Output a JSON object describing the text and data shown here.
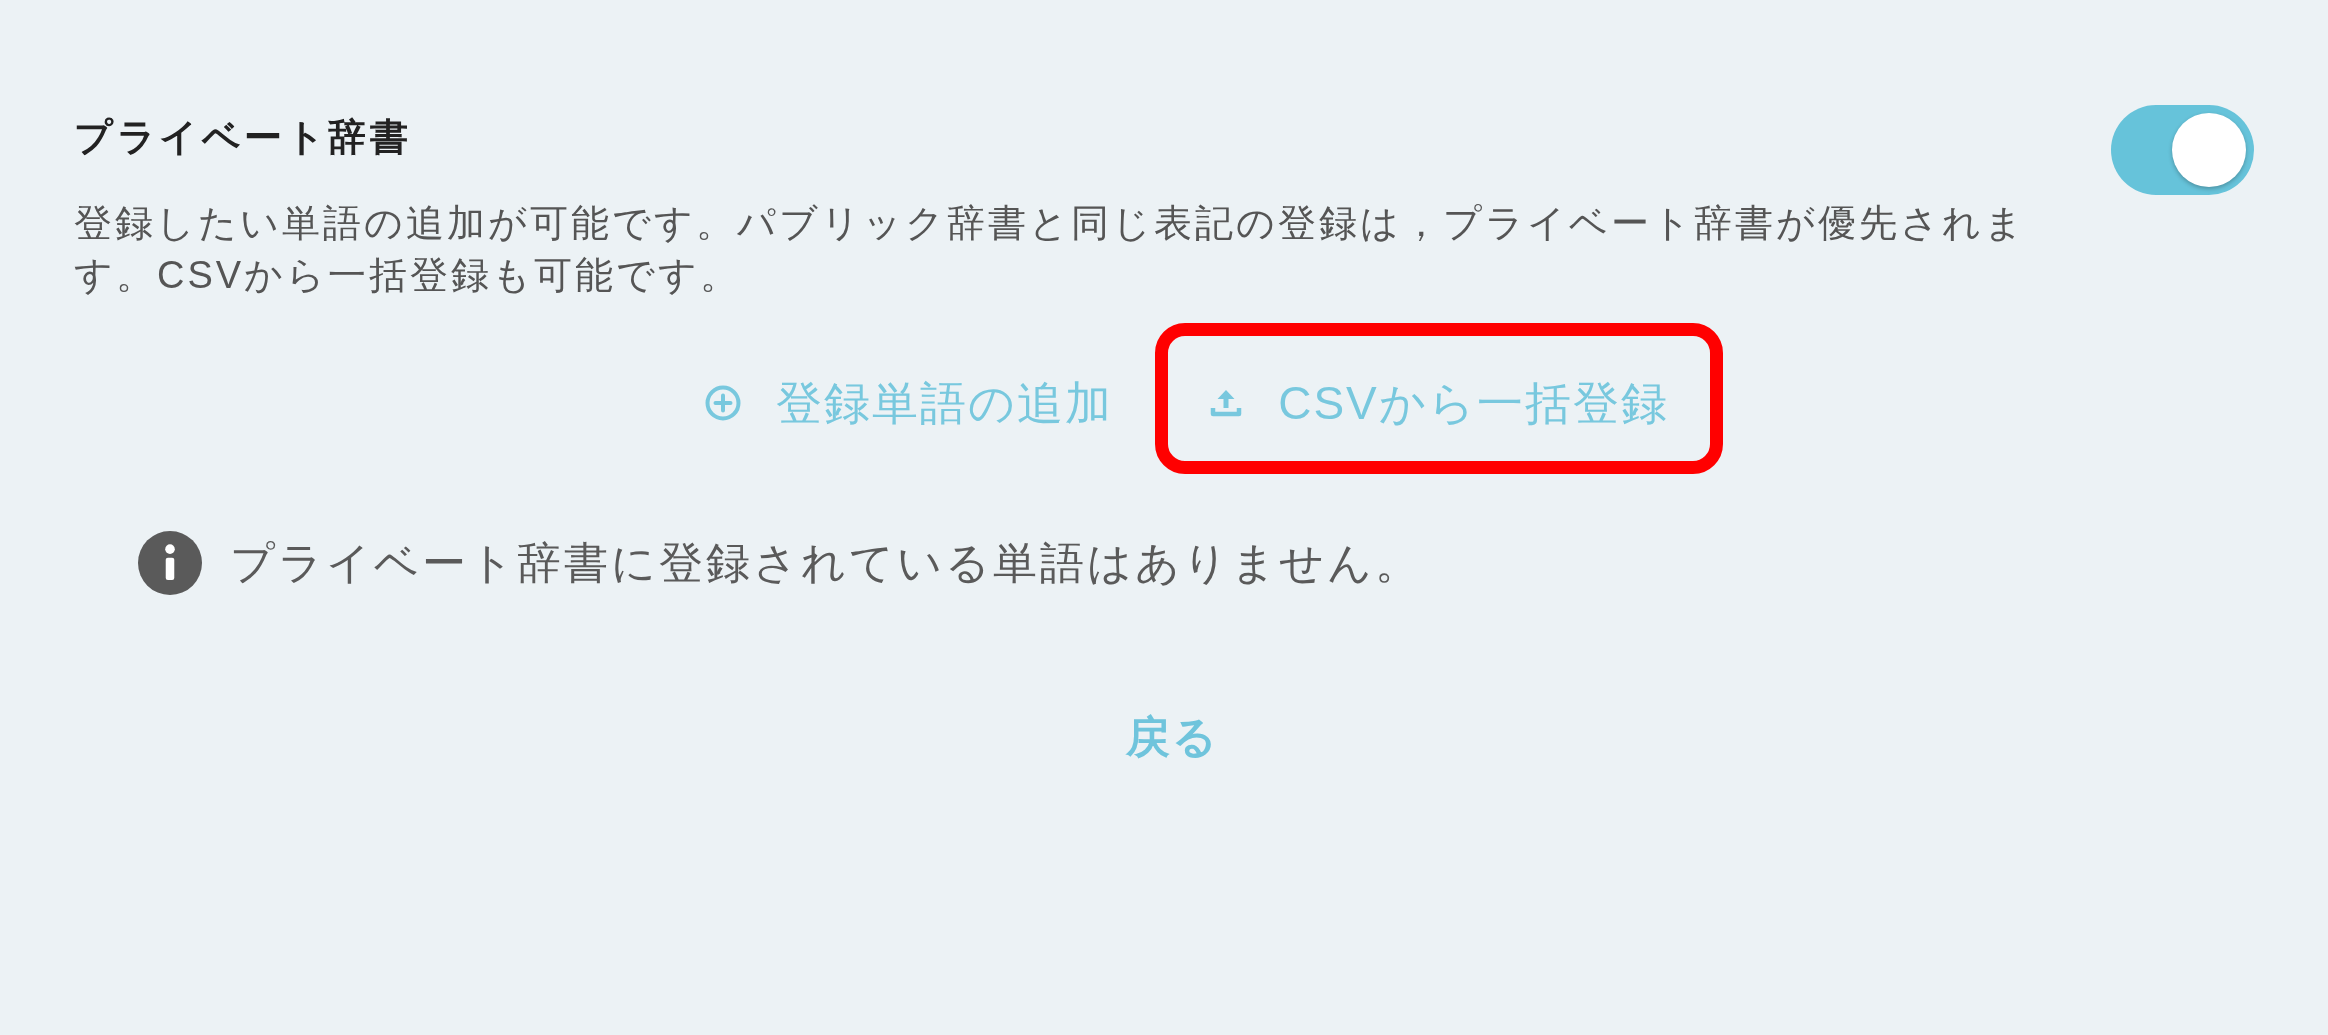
{
  "section": {
    "title": "プライベート辞書",
    "description": "登録したい単語の追加が可能です。パブリック辞書と同じ表記の登録は，プライベート辞書が優先されます。CSVから一括登録も可能です。",
    "toggle": {
      "on": true
    }
  },
  "actions": [
    {
      "kind": "add",
      "label": "登録単語の追加",
      "highlighted": false
    },
    {
      "kind": "upload",
      "label": "CSVから一括登録",
      "highlighted": true
    }
  ],
  "notice": {
    "text": "プライベート辞書に登録されている単語はありません。"
  },
  "back_button": {
    "label": "戻る"
  }
}
